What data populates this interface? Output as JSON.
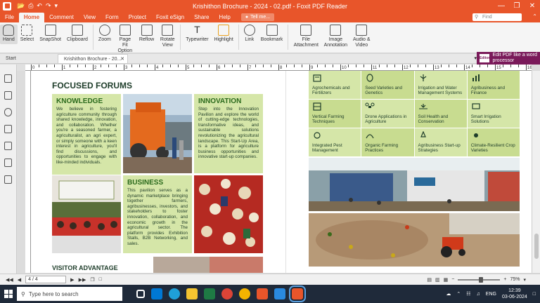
{
  "window": {
    "title": "Krishithon Brochure - 2024 - 02.pdf - Foxit PDF Reader"
  },
  "menu": {
    "tabs": [
      "File",
      "Home",
      "Comment",
      "View",
      "Form",
      "Protect",
      "Foxit eSign",
      "Share",
      "Help"
    ],
    "active": "Home",
    "tell_me": "Tell me...",
    "find_placeholder": "Find"
  },
  "ribbon": {
    "buttons": [
      {
        "label": "Hand",
        "icon": "hand-icon"
      },
      {
        "label": "Select",
        "icon": "select-icon"
      },
      {
        "label": "SnapShot",
        "icon": "snapshot-icon"
      },
      {
        "label": "Clipboard",
        "icon": "clipboard-icon"
      },
      {
        "label": "Zoom",
        "icon": "zoom-icon"
      },
      {
        "label": "Page Fit Option",
        "icon": "page-fit-icon"
      },
      {
        "label": "Reflow",
        "icon": "reflow-icon"
      },
      {
        "label": "Rotate View",
        "icon": "rotate-icon"
      },
      {
        "label": "Typewriter",
        "icon": "typewriter-icon"
      },
      {
        "label": "Highlight",
        "icon": "highlight-icon"
      },
      {
        "label": "Link",
        "icon": "link-icon"
      },
      {
        "label": "Bookmark",
        "icon": "bookmark-icon"
      },
      {
        "label": "File Attachment",
        "icon": "attachment-icon"
      },
      {
        "label": "Image Annotation",
        "icon": "image-annotation-icon"
      },
      {
        "label": "Audio & Video",
        "icon": "audio-video-icon"
      }
    ],
    "promo": "Edit PDF like a word processor",
    "promo_logo": "Editor"
  },
  "doc_tabs": {
    "start": "Start",
    "current": "Krishithon Brochure - 20..."
  },
  "ruler": {
    "labels": [
      "0",
      "1",
      "2",
      "3",
      "4",
      "5",
      "6",
      "7",
      "8",
      "9",
      "10",
      "11",
      "12",
      "13",
      "14",
      "15",
      "16"
    ]
  },
  "left_page": {
    "title": "FOCUSED FORUMS",
    "knowledge": {
      "heading": "KNOWLEDGE",
      "body": "We believe in fostering agriculture community through shared knowledge, innovation, and collaboration. Whether you're a seasoned farmer, a agriculturalist, an agri expert, or simply someone with a keen interest in agriculture, you'll find discussions, and opportunities to engage with like-minded individuals."
    },
    "innovation": {
      "heading": "INNOVATION",
      "body": "Step into the Innovation Pavilion and explore the world of cutting-edge technologies, transformative ideas, and sustainable solutions revolutionizing the agricultural landscape. This Start-Up Area, is a platform for agriculture business opportunities and innovative start-up companies."
    },
    "business": {
      "heading": "BUSINESS",
      "body": "This pavilion serves as a dynamic marketplace bringing together farmers, agribusinesses, investors, and stakeholders to foster innovation, collaboration, and economic growth in the agricultural sector. The platform provides Exhibition Stalls, B2B Networking, and sales."
    },
    "visitor_title": "VISITOR ADVANTAGE"
  },
  "right_page": {
    "cells": [
      {
        "label": "Agrochemicals and Fertilizers",
        "icon": "fertilizer-icon"
      },
      {
        "label": "Seed Varieties and Genetics",
        "icon": "seed-icon"
      },
      {
        "label": "Irrigation and Water Management Systems",
        "icon": "irrigation-icon"
      },
      {
        "label": "Agribusiness and Finance",
        "icon": "finance-icon"
      },
      {
        "label": "Vertical Farming Techniques",
        "icon": "vertical-farming-icon"
      },
      {
        "label": "Drone Applications in Agriculture",
        "icon": "drone-icon"
      },
      {
        "label": "Soil Health and Conservation",
        "icon": "soil-icon"
      },
      {
        "label": "Smart Irrigation Solutions",
        "icon": "smart-irrigation-icon"
      },
      {
        "label": "Integrated Pest Management",
        "icon": "pest-icon"
      },
      {
        "label": "Organic Farming Practices",
        "icon": "organic-icon"
      },
      {
        "label": "Agribusiness Start-up Strategies",
        "icon": "startup-icon"
      },
      {
        "label": "Climate-Resilient Crop Varieties",
        "icon": "climate-icon"
      }
    ]
  },
  "status": {
    "page": "4 / 4",
    "zoom": "75%",
    "zoom_level": 0.55
  },
  "taskbar": {
    "search_placeholder": "Type here to search",
    "language": "ENG",
    "time": "12:39",
    "date": "03-06-2024"
  },
  "colors": {
    "accent": "#e8552a",
    "panel_green": "#d5e6a8",
    "heading_green": "#2a6a1c"
  }
}
